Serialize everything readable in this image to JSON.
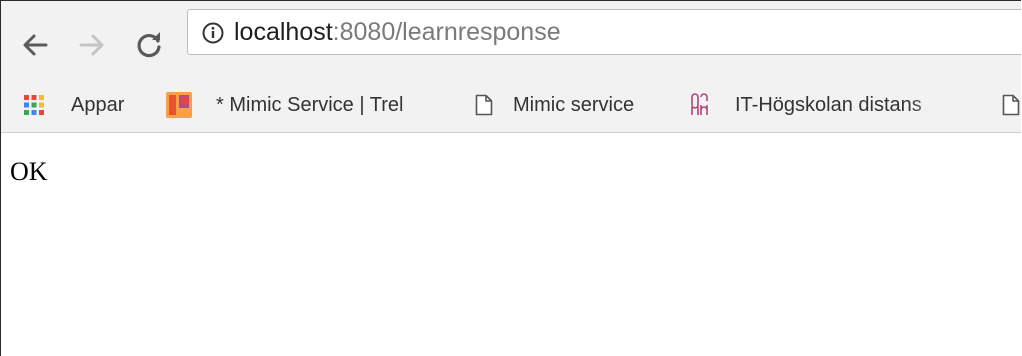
{
  "toolbar": {
    "url": {
      "host": "localhost",
      "rest": ":8080/learnresponse"
    }
  },
  "bookmarks": [
    {
      "label": "Appar",
      "icon": "apps-grid-icon"
    },
    {
      "label": "* Mimic Service | Trel",
      "icon": "trello-icon"
    },
    {
      "label": "Mimic service",
      "icon": "page-icon"
    },
    {
      "label": "IT-Högskolan distans",
      "icon": "itslearning-icon"
    },
    {
      "label": "",
      "icon": "page-icon"
    }
  ],
  "page": {
    "body_text": "OK"
  },
  "colors": {
    "chrome_bg": "#f2f2f2",
    "url_host": "#202020",
    "url_rest": "#7a7a7a",
    "nav_active": "#5a5a5a",
    "nav_disabled": "#c4c4c4"
  }
}
